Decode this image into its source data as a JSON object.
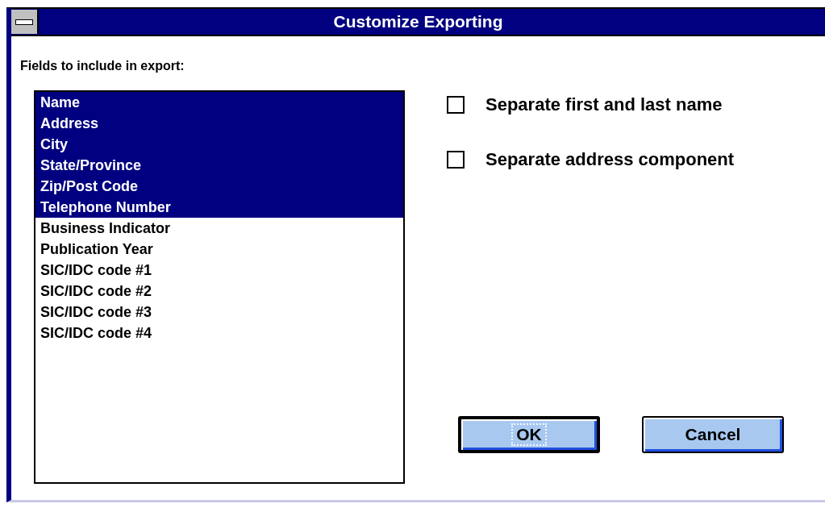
{
  "window": {
    "title": "Customize Exporting"
  },
  "fields_label": "Fields to include in export:",
  "fields": [
    {
      "label": "Name",
      "selected": true
    },
    {
      "label": "Address",
      "selected": true
    },
    {
      "label": "City",
      "selected": true
    },
    {
      "label": "State/Province",
      "selected": true
    },
    {
      "label": "Zip/Post Code",
      "selected": true
    },
    {
      "label": "Telephone Number",
      "selected": true
    },
    {
      "label": "Business Indicator",
      "selected": false
    },
    {
      "label": "Publication Year",
      "selected": false
    },
    {
      "label": "SIC/IDC code #1",
      "selected": false
    },
    {
      "label": "SIC/IDC code #2",
      "selected": false
    },
    {
      "label": "SIC/IDC code #3",
      "selected": false
    },
    {
      "label": "SIC/IDC code #4",
      "selected": false
    }
  ],
  "options": [
    {
      "label": "Separate first and last name",
      "checked": false
    },
    {
      "label": "Separate address component",
      "checked": false
    }
  ],
  "buttons": [
    {
      "label": "OK",
      "default": true,
      "focused": true
    },
    {
      "label": "Cancel",
      "default": false,
      "focused": false
    }
  ]
}
